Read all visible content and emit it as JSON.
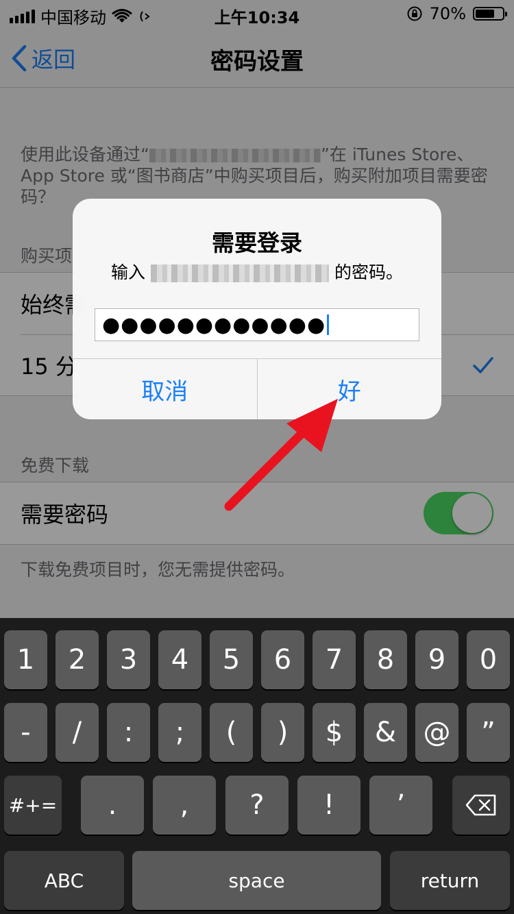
{
  "status_bar": {
    "carrier": "中国移动",
    "time": "上午10:34",
    "battery_percent": "70%",
    "battery_level": 0.7
  },
  "nav": {
    "back_label": "返回",
    "title": "密码设置"
  },
  "settings": {
    "description_part1": "使用此设备通过“",
    "description_part2": "”在 iTunes Store、App Store 或“图书商店”中购买项目后，购买附加项目需要密码？",
    "purchase_section_header": "购买项",
    "purchase_options": [
      "始终需",
      "15 分"
    ],
    "selected_option_index": 1,
    "free_section_header": "免费下载",
    "require_password_label": "需要密码",
    "require_password_on": true,
    "footer_note": "下载免费项目时，您无需提供密码。"
  },
  "alert": {
    "title": "需要登录",
    "message_prefix": "输入",
    "message_suffix": "的密码。",
    "password_value": "●●●●●●●●●●●●",
    "cancel_label": "取消",
    "ok_label": "好"
  },
  "keyboard": {
    "row1": [
      "1",
      "2",
      "3",
      "4",
      "5",
      "6",
      "7",
      "8",
      "9",
      "0"
    ],
    "row2": [
      "-",
      "/",
      ":",
      ";",
      "(",
      ")",
      "$",
      "&",
      "@",
      "”"
    ],
    "row3_symbols": "#+=",
    "row3": [
      ".",
      ",",
      "?",
      "!",
      "’"
    ],
    "abc_label": "ABC",
    "space_label": "space",
    "return_label": "return"
  },
  "colors": {
    "accent": "#1b7ff6",
    "toggle_on": "#4cd964",
    "annotation_arrow": "#e8131f"
  }
}
